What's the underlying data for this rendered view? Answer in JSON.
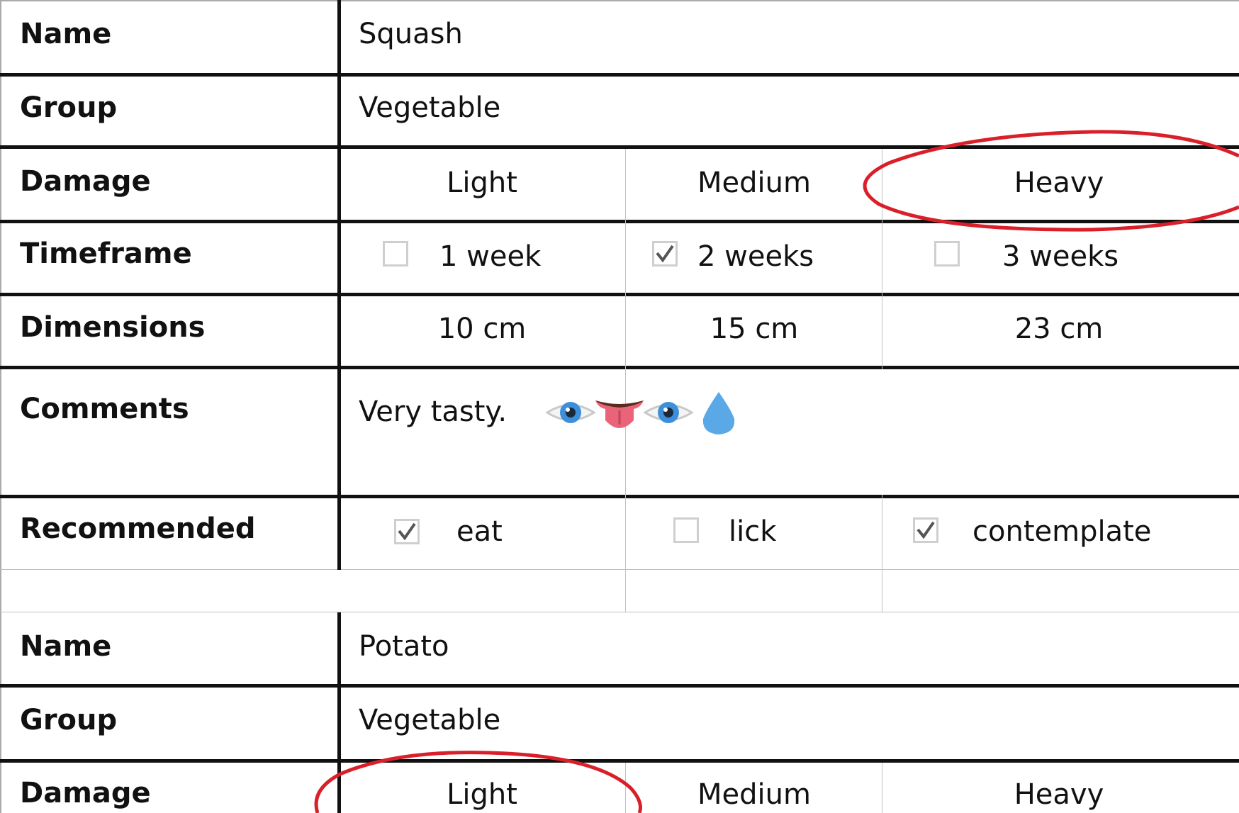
{
  "records": [
    {
      "name_label": "Name",
      "name_value": "Squash",
      "group_label": "Group",
      "group_value": "Vegetable",
      "damage_label": "Damage",
      "damage_options": [
        "Light",
        "Medium",
        "Heavy"
      ],
      "damage_circled": "Heavy",
      "timeframe_label": "Timeframe",
      "timeframe_options": [
        {
          "label": "1 week",
          "checked": false
        },
        {
          "label": "2 weeks",
          "checked": true
        },
        {
          "label": "3 weeks",
          "checked": false
        }
      ],
      "dimensions_label": "Dimensions",
      "dimensions_values": [
        "10 cm",
        "15 cm",
        "23 cm"
      ],
      "comments_label": "Comments",
      "comments_text": "Very tasty.",
      "comments_emoji": [
        "eye-icon",
        "tongue-icon",
        "eye-icon",
        "droplet-icon"
      ],
      "recommended_label": "Recommended",
      "recommended_options": [
        {
          "label": "eat",
          "checked": true
        },
        {
          "label": "lick",
          "checked": false
        },
        {
          "label": "contemplate",
          "checked": true
        }
      ]
    },
    {
      "name_label": "Name",
      "name_value": "Potato",
      "group_label": "Group",
      "group_value": "Vegetable",
      "damage_label": "Damage",
      "damage_options": [
        "Light",
        "Medium",
        "Heavy"
      ],
      "damage_circled": "Light"
    }
  ],
  "colors": {
    "grid_line": "#111111",
    "thin_line": "#c2c2c2",
    "circle_mark": "#d9202a",
    "checkbox_border": "#cfcfcf",
    "checkmark": "#555555"
  }
}
